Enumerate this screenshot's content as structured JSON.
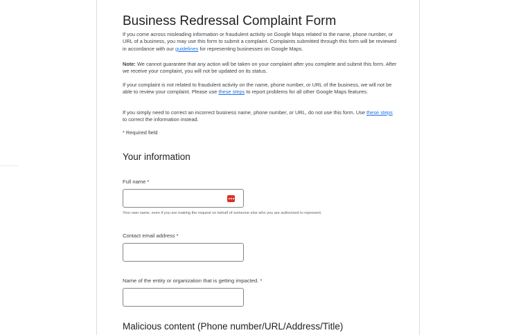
{
  "form": {
    "title": "Business Redressal Complaint Form",
    "intro": {
      "text1": "If you come across misleading information or fraudulent activity on Google Maps related to the name, phone number, or URL of a business, you may use this form to submit a complaint. Complaints submitted through this form will be reviewed in accordance with our ",
      "link": "guidelines",
      "text2": " for representing businesses on Google Maps."
    },
    "note": {
      "bold": "Note:",
      "text": " We cannot guarantee that any action will be taken on your complaint after you complete and submit this form. After we receive your complaint, you will not be updated on its status."
    },
    "not_related": {
      "text1": "If your complaint is not related to fraudulent activity on the name, phone number, or URL of the business, we will not be able to review your complaint. Please use ",
      "link": "these steps",
      "text2": " to report problems for all other Google Maps features."
    },
    "correct": {
      "text1": "If you simply need to correct an incorrect business name, phone number, or URL, do not use this form. Use ",
      "link": "these steps",
      "text2": " to correct the information instead."
    },
    "required_note": "* Required field"
  },
  "your_information": {
    "heading": "Your information",
    "full_name": {
      "label": "Full name *",
      "value": "",
      "helper": "Your own name, even if you are making the request on behalf of someone else who you are authorized to represent."
    },
    "email": {
      "label": "Contact email address *",
      "value": ""
    },
    "entity": {
      "label": "Name of the entity or organization that is getting impacted. *",
      "value": ""
    }
  },
  "malicious_content": {
    "heading": "Malicious content (Phone number/URL/Address/Title)"
  },
  "colors": {
    "link": "#1a73e8",
    "text": "#202124",
    "password_manager_icon": "#d93025"
  },
  "icons": {
    "password_manager": "password-manager-icon"
  }
}
